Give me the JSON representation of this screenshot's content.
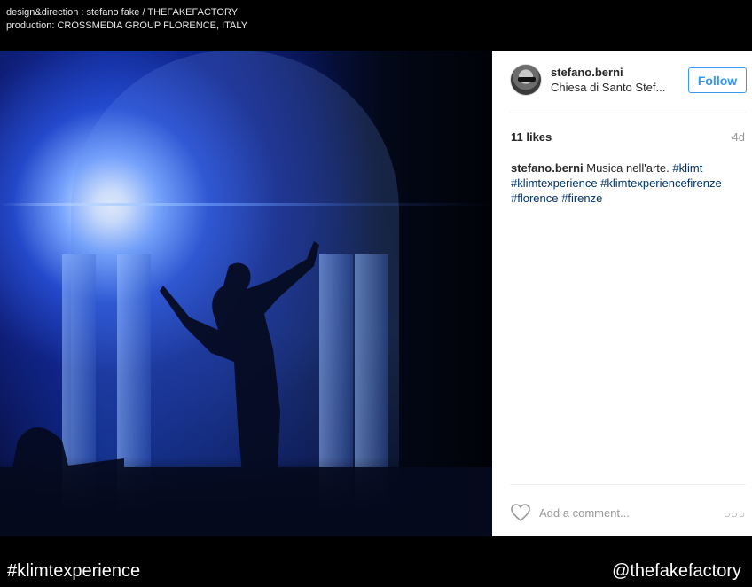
{
  "credits": {
    "line1": "design&direction : stefano fake / THEFAKEFACTORY",
    "line2": "production: CROSSMEDIA GROUP FLORENCE, ITALY"
  },
  "post": {
    "username": "stefano.berni",
    "location": "Chiesa di Santo Stef...",
    "follow_label": "Follow",
    "likes": "11 likes",
    "age": "4d",
    "caption": {
      "author": "stefano.berni",
      "text": " Musica nell'arte. ",
      "tags": [
        "#klimt",
        "#klimtexperience",
        "#klimtexperiencefirenze",
        "#florence",
        "#firenze"
      ]
    },
    "comment_placeholder": "Add a comment...",
    "more_label": "○○○"
  },
  "icons": {
    "like": "heart-icon",
    "more": "more-options-icon",
    "avatar": "avatar"
  },
  "colors": {
    "accent": "#3897f0",
    "hashtag": "#003569",
    "muted": "#999999"
  },
  "footer": {
    "left": "#klimtexperience",
    "right": "@thefakefactory"
  }
}
